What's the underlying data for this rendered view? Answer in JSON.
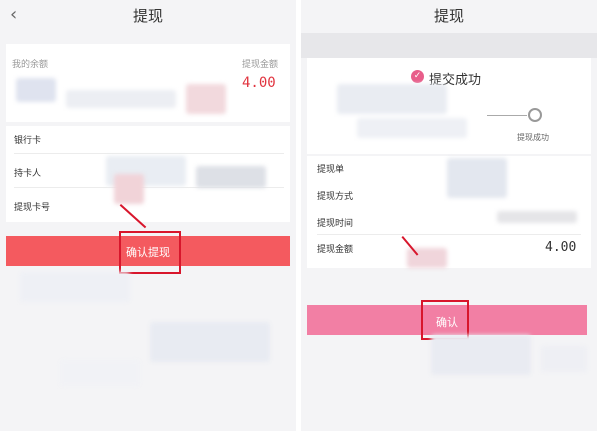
{
  "left": {
    "title": "提现",
    "back_icon": "‹",
    "balance_label": "我的余额",
    "amount_label": "提现金额",
    "amount_value": "4.00",
    "bank_card_label": "银行卡",
    "cardholder_label": "持卡人",
    "card_number_label": "提现卡号",
    "confirm_button": "确认提现",
    "colors": {
      "button": "#f45a5f",
      "accent": "#e1343f",
      "callout": "#d8162c"
    }
  },
  "right": {
    "title": "提现",
    "success_icon": "✓",
    "success_title": "提交成功",
    "step_label": "提现成功",
    "order_label": "提现单",
    "method_label": "提现方式",
    "time_label": "提现时间",
    "amount_label": "提现金额",
    "amount_value": "4.00",
    "confirm_button": "确认",
    "colors": {
      "button": "#f27fa4",
      "success": "#e85d8a"
    }
  }
}
